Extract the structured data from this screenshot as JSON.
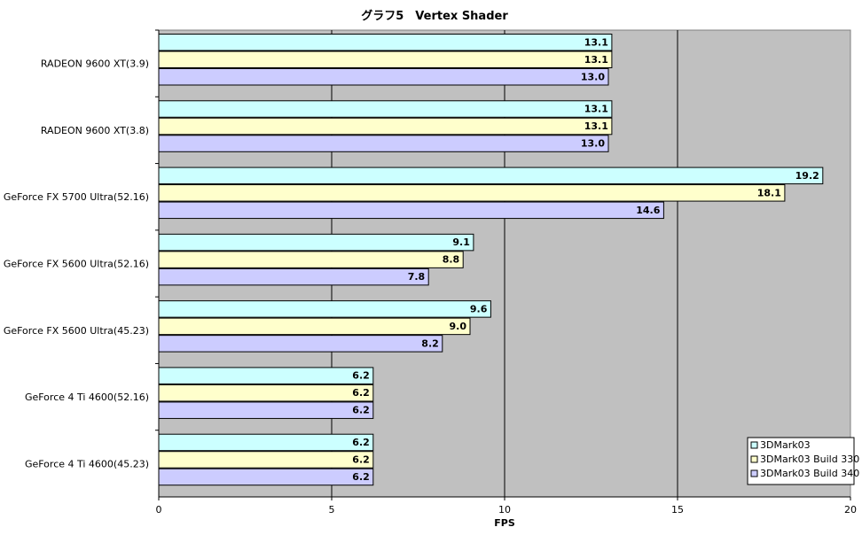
{
  "chart_data": {
    "type": "bar",
    "orientation": "horizontal",
    "title": "グラフ5　Vertex Shader",
    "xlabel": "FPS",
    "ylabel": "",
    "xlim": [
      0,
      20
    ],
    "xticks": [
      "0",
      "5",
      "10",
      "15",
      "20"
    ],
    "grid": true,
    "legend_position": "bottom-right",
    "categories": [
      "RADEON 9600 XT(3.9)",
      "RADEON 9600 XT(3.8)",
      "GeForce FX 5700 Ultra(52.16)",
      "GeForce FX 5600 Ultra(52.16)",
      "GeForce FX 5600 Ultra(45.23)",
      "GeForce 4 Ti 4600(52.16)",
      "GeForce 4 Ti 4600(45.23)"
    ],
    "series": [
      {
        "name": "3DMark03",
        "color": "#ccffff",
        "values": [
          13.1,
          13.1,
          19.2,
          9.1,
          9.6,
          6.2,
          6.2
        ],
        "labels": [
          "13.1",
          "13.1",
          "19.2",
          "9.1",
          "9.6",
          "6.2",
          "6.2"
        ]
      },
      {
        "name": "3DMark03 Build 330",
        "color": "#ffffcc",
        "values": [
          13.1,
          13.1,
          18.1,
          8.8,
          9.0,
          6.2,
          6.2
        ],
        "labels": [
          "13.1",
          "13.1",
          "18.1",
          "8.8",
          "9.0",
          "6.2",
          "6.2"
        ]
      },
      {
        "name": "3DMark03 Build 340",
        "color": "#ccccff",
        "values": [
          13.0,
          13.0,
          14.6,
          7.8,
          8.2,
          6.2,
          6.2
        ],
        "labels": [
          "13.0",
          "13.0",
          "14.6",
          "7.8",
          "8.2",
          "6.2",
          "6.2"
        ]
      }
    ],
    "plot_background": "#c0c0c0"
  }
}
